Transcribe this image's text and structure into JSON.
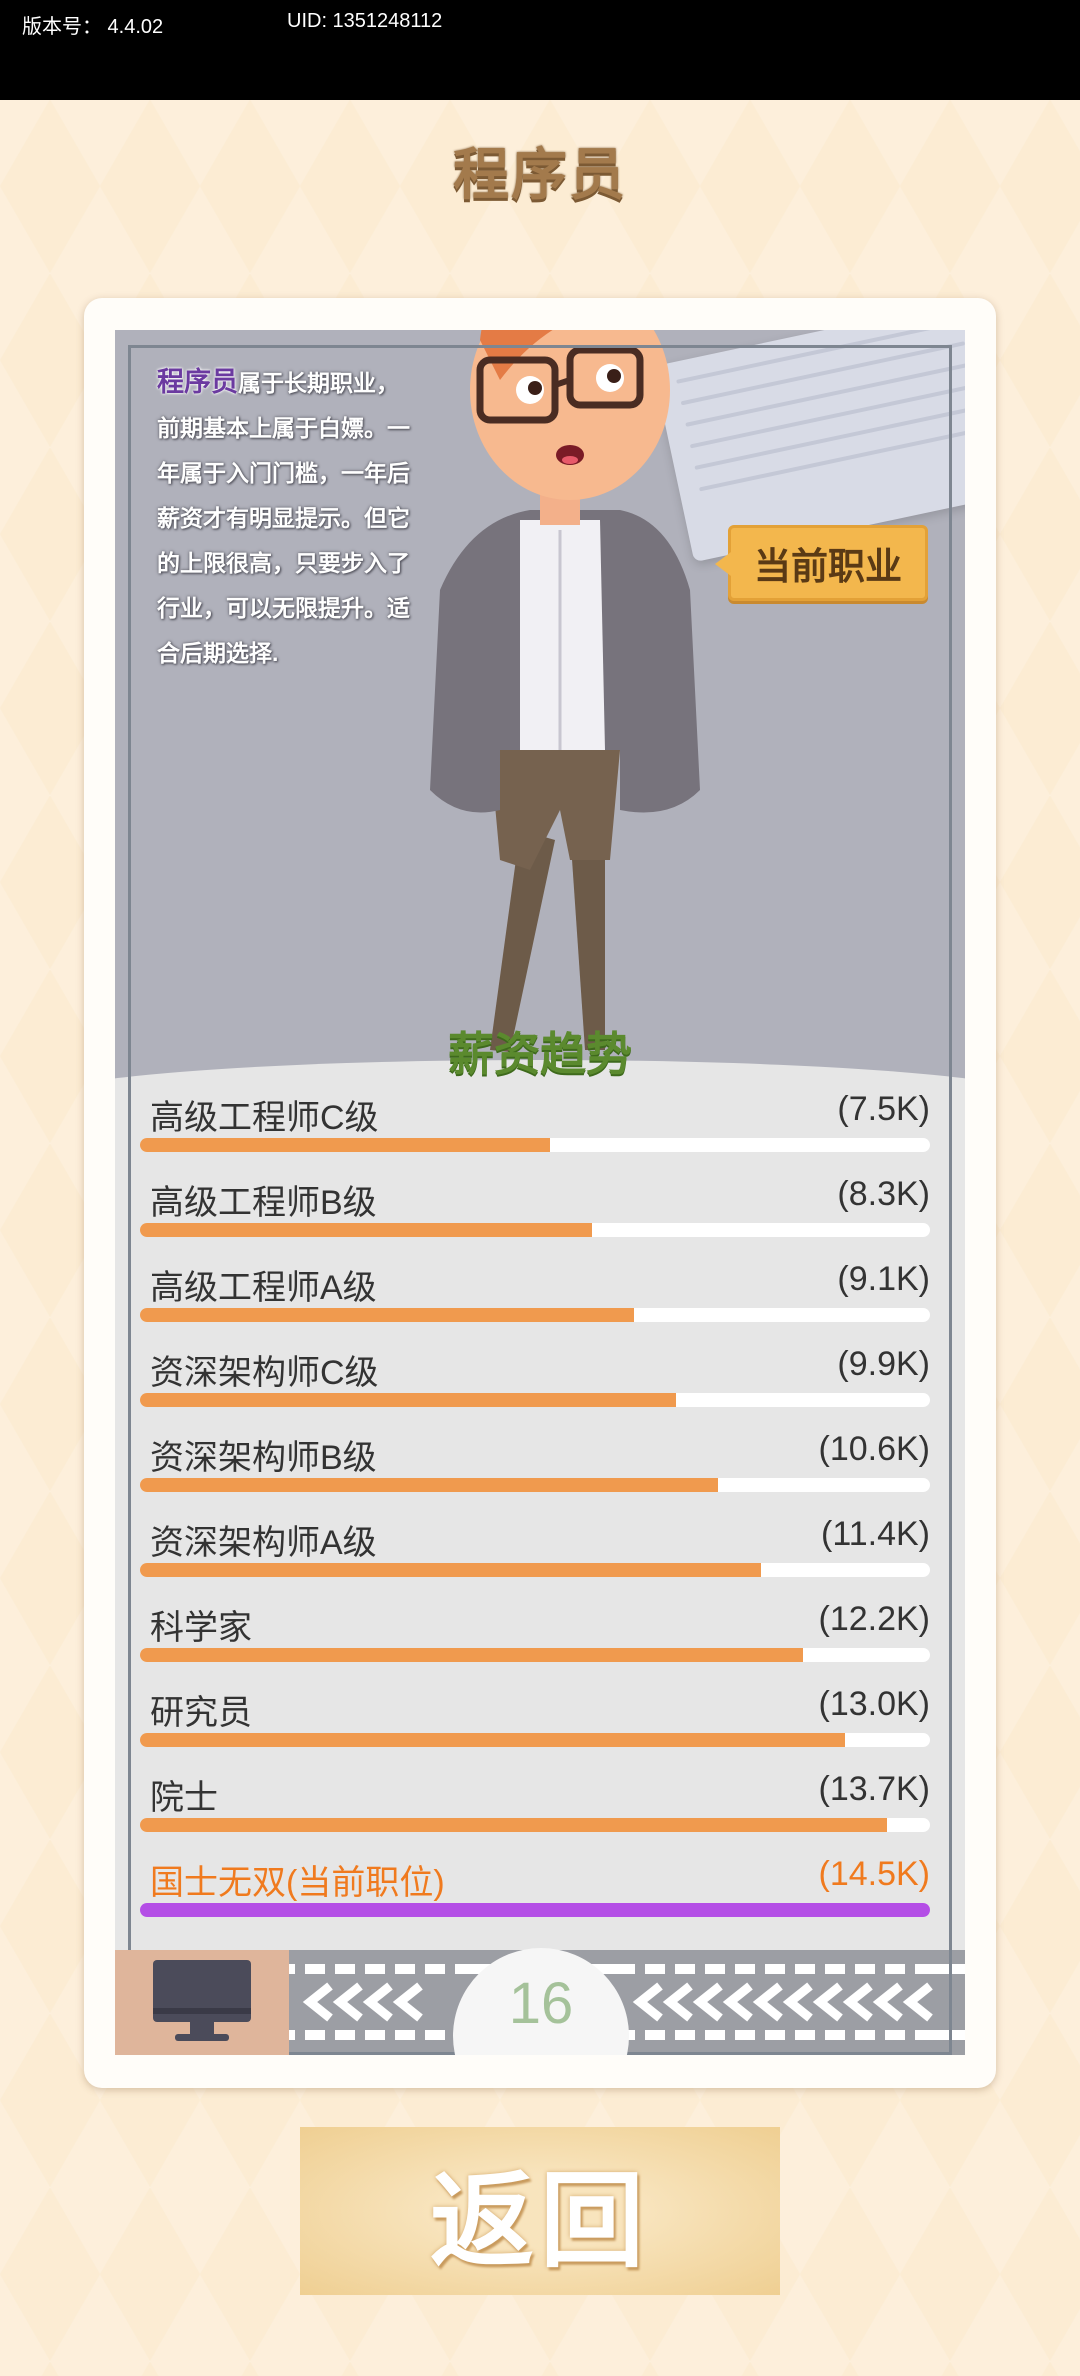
{
  "status_bar": {
    "version_label": "版本号： 4.4.02",
    "uid_label": "UID: 1351248112"
  },
  "page": {
    "title": "程序员",
    "current_job_badge": "当前职业",
    "section_title": "薪资趋势",
    "level": "16",
    "back_label": "返回"
  },
  "intro": {
    "highlight": "程序员",
    "text": "属于长期职业，前期基本上属于白嫖。一年属于入门门槛，一年后薪资才有明显提示。但它的上限很高，只要步入了行业，可以无限提升。适合后期选择."
  },
  "salary_levels": [
    {
      "name": "高级工程师C级",
      "salary": "(7.5K)",
      "progress": 0.519
    },
    {
      "name": "高级工程师B级",
      "salary": "(8.3K)",
      "progress": 0.572
    },
    {
      "name": "高级工程师A级",
      "salary": "(9.1K)",
      "progress": 0.625
    },
    {
      "name": "资深架构师C级",
      "salary": "(9.9K)",
      "progress": 0.679
    },
    {
      "name": "资深架构师B级",
      "salary": "(10.6K)",
      "progress": 0.732
    },
    {
      "name": "资深架构师A级",
      "salary": "(11.4K)",
      "progress": 0.786
    },
    {
      "name": "科学家",
      "salary": "(12.2K)",
      "progress": 0.839
    },
    {
      "name": "研究员",
      "salary": "(13.0K)",
      "progress": 0.893
    },
    {
      "name": "院士",
      "salary": "(13.7K)",
      "progress": 0.946
    },
    {
      "name": "国士无双(当前职位)",
      "salary": "(14.5K)",
      "progress": 1.0,
      "current": true
    }
  ],
  "icons": {
    "job_icon": "computer-monitor-icon",
    "strip_arrows": "chevron-left-icon"
  },
  "colors": {
    "bar_fill": "#f09a4e",
    "current_bar_fill": "#b44ee6",
    "current_text": "#f07a1e",
    "title": "#a37a4c"
  }
}
